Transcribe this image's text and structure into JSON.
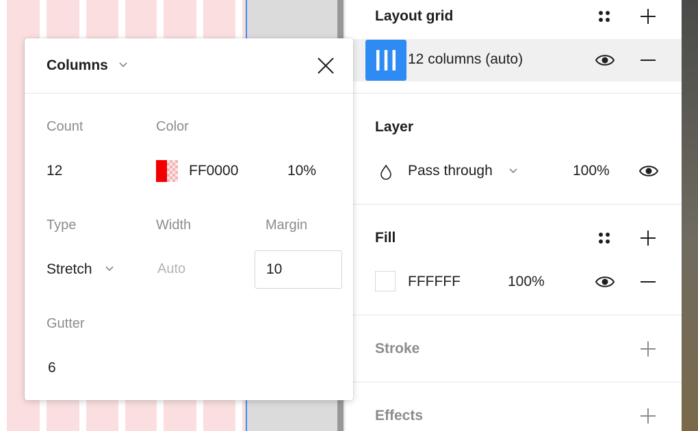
{
  "layout_grid": {
    "title": "Layout grid",
    "grid_label": "12 columns (auto)"
  },
  "layer": {
    "title": "Layer",
    "blend_mode": "Pass through",
    "opacity": "100%"
  },
  "fill": {
    "title": "Fill",
    "hex": "FFFFFF",
    "opacity": "100%"
  },
  "stroke": {
    "title": "Stroke"
  },
  "effects": {
    "title": "Effects"
  },
  "popup": {
    "title": "Columns",
    "count_label": "Count",
    "count_value": "12",
    "color_label": "Color",
    "color_hex": "FF0000",
    "color_opacity": "10%",
    "type_label": "Type",
    "type_value": "Stretch",
    "width_label": "Width",
    "width_placeholder": "Auto",
    "margin_label": "Margin",
    "margin_value": "10",
    "gutter_label": "Gutter",
    "gutter_value": "6"
  },
  "colors": {
    "accent": "#2d8bf3",
    "grid_color": "#ff0000",
    "column_tint": "#fbdfe0"
  },
  "icons": [
    "chevron-down-icon",
    "close-icon",
    "drag-dots-icon",
    "plus-icon",
    "minus-icon",
    "eye-icon",
    "columns-icon",
    "drop-icon"
  ]
}
